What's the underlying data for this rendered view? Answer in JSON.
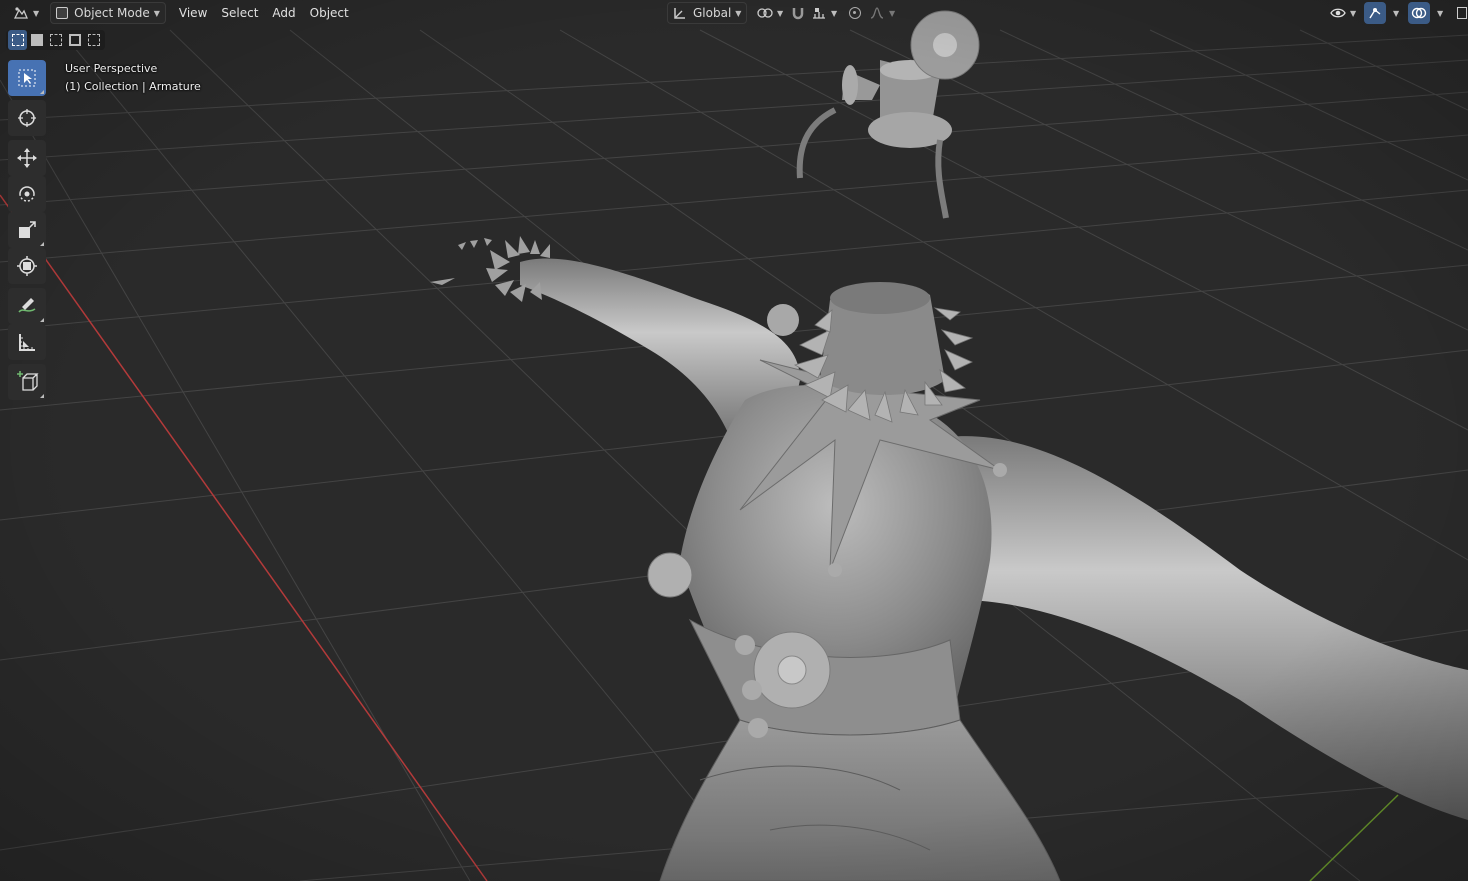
{
  "header": {
    "editor_type_icon": "editor-type-icon",
    "mode_label": "Object Mode",
    "menus": [
      "View",
      "Select",
      "Add",
      "Object"
    ],
    "transform_orientation": "Global"
  },
  "viewport": {
    "perspective_label": "User Perspective",
    "collection_label": "(1) Collection | Armature"
  },
  "toolbar": {
    "tools": [
      "select-box-tool",
      "cursor-tool",
      "move-tool",
      "rotate-tool",
      "scale-tool",
      "transform-tool",
      "annotate-tool",
      "measure-tool",
      "add-cube-tool"
    ]
  },
  "colors": {
    "background": "#2a2a2a",
    "grid": "#3f3f3f",
    "x_axis": "#b33a3a",
    "y_axis": "#6b9a2c",
    "accent": "#4772b3",
    "model": "#8a8a8a"
  }
}
